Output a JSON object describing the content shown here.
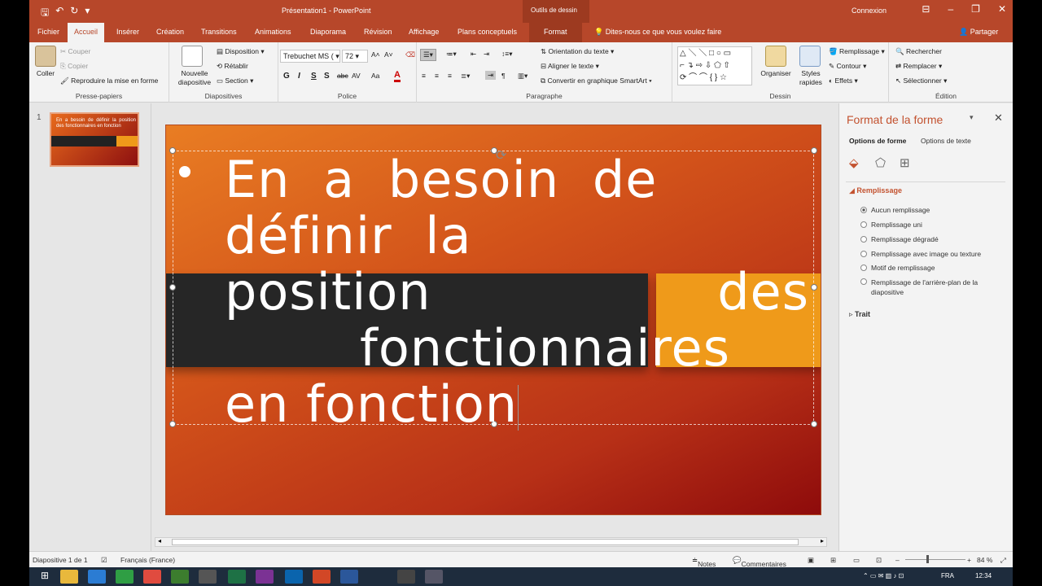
{
  "app": {
    "title": "Présentation1 - PowerPoint",
    "context_tab_group": "Outils de dessin",
    "signin": "Connexion",
    "share": "Partager",
    "tell_me": "Dites-nous ce que vous voulez faire"
  },
  "tabs": [
    "Fichier",
    "Accueil",
    "Insérer",
    "Création",
    "Transitions",
    "Animations",
    "Diaporama",
    "Révision",
    "Affichage",
    "Plans conceptuels",
    "Format"
  ],
  "ribbon": {
    "clipboard": {
      "paste": "Coller",
      "cut": "Couper",
      "copy": "Copier",
      "format_painter": "Reproduire la mise en forme",
      "label": "Presse-papiers"
    },
    "slides": {
      "new_slide": "Nouvelle diapositive",
      "layout": "Disposition",
      "reset": "Rétablir",
      "section": "Section",
      "label": "Diapositives"
    },
    "font": {
      "name": "Trebuchet MS (",
      "size": "72",
      "bold": "G",
      "italic": "I",
      "underline": "S",
      "shadow": "S",
      "strike": "abc",
      "spacing": "AV",
      "case": "Aa",
      "label": "Police"
    },
    "paragraph": {
      "text_direction": "Orientation du texte",
      "align_text": "Aligner le texte",
      "smartart": "Convertir en graphique SmartArt",
      "label": "Paragraphe"
    },
    "drawing": {
      "arrange": "Organiser",
      "quick_styles": "Styles rapides",
      "fill": "Remplissage",
      "outline": "Contour",
      "effects": "Effets",
      "label": "Dessin"
    },
    "editing": {
      "find": "Rechercher",
      "replace": "Remplacer",
      "select": "Sélectionner",
      "label": "Édition"
    }
  },
  "thumbnails": [
    {
      "number": "1",
      "text": "En a besoin de définir la position des fonctionnaires en fonction"
    }
  ],
  "slide": {
    "line1": "En a besoin de définir la",
    "line2a": "position",
    "line2b": "des",
    "line3": "fonctionnaires",
    "line4": "en fonction"
  },
  "format_pane": {
    "title": "Format de la forme",
    "tab_shape": "Options de forme",
    "tab_text": "Options de texte",
    "section_fill": "Remplissage",
    "options": [
      {
        "label": "Aucun remplissage",
        "selected": true
      },
      {
        "label": "Remplissage uni",
        "selected": false
      },
      {
        "label": "Remplissage dégradé",
        "selected": false
      },
      {
        "label": "Remplissage avec image ou texture",
        "selected": false
      },
      {
        "label": "Motif de remplissage",
        "selected": false
      },
      {
        "label": "Remplissage de l'arrière-plan de la diapositive",
        "selected": false
      }
    ],
    "section_line": "Trait"
  },
  "status": {
    "slide_count": "Diapositive 1 de 1",
    "language": "Français (France)",
    "notes": "Notes",
    "comments": "Commentaires",
    "zoom": "84 %"
  },
  "taskbar": {
    "lang": "FRA",
    "time": "12:34"
  }
}
